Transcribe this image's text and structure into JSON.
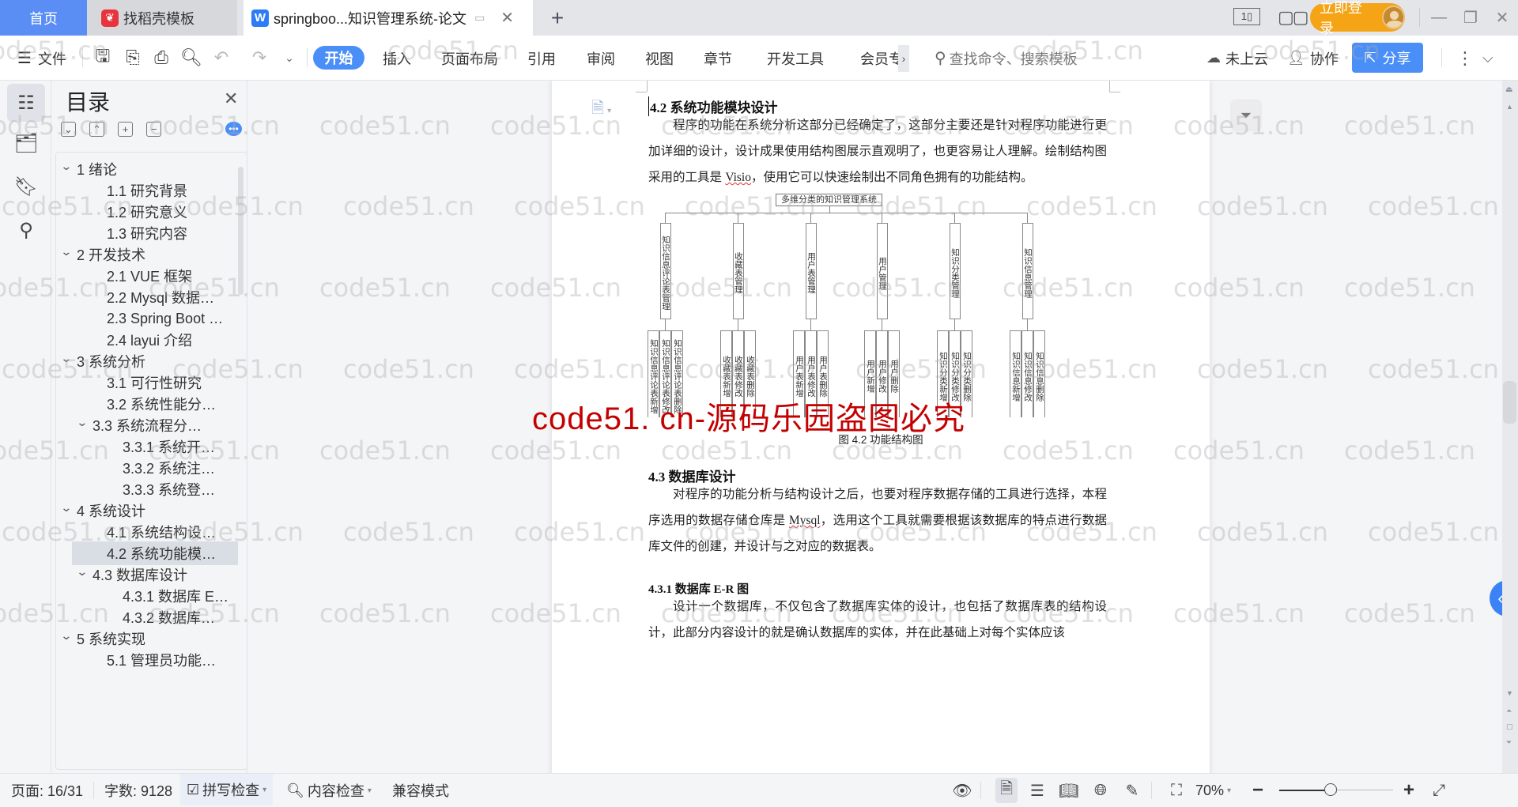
{
  "tabs": {
    "home": "首页",
    "daoke": "找稻壳模板",
    "doc": "springboo...知识管理系统-论文",
    "add": "+"
  },
  "titlebar": {
    "login": "立即登录"
  },
  "toolbar": {
    "file": "文件",
    "menus": [
      "开始",
      "插入",
      "页面布局",
      "引用",
      "审阅",
      "视图",
      "章节",
      "开发工具",
      "会员专"
    ],
    "search_placeholder": "查找命令、搜索模板",
    "cloud": "未上云",
    "collab": "协作",
    "share": "分享"
  },
  "toc": {
    "title": "目录",
    "items": [
      {
        "label": "1  绪论",
        "level": 1,
        "expanded": true
      },
      {
        "label": "1.1  研究背景",
        "level": 2
      },
      {
        "label": "1.2  研究意义",
        "level": 2
      },
      {
        "label": "1.3  研究内容",
        "level": 2
      },
      {
        "label": "2  开发技术",
        "level": 1,
        "expanded": true
      },
      {
        "label": "2.1 VUE 框架",
        "level": 2
      },
      {
        "label": "2.2 Mysql 数据…",
        "level": 2
      },
      {
        "label": "2.3 Spring Boot …",
        "level": 2
      },
      {
        "label": "2.4 layui 介绍",
        "level": 2
      },
      {
        "label": "3  系统分析",
        "level": 1,
        "expanded": true
      },
      {
        "label": "3.1 可行性研究",
        "level": 2
      },
      {
        "label": "3.2 系统性能分…",
        "level": 2
      },
      {
        "label": "3.3  系统流程分…",
        "level": 2,
        "expanded": true
      },
      {
        "label": "3.3.1  系统开…",
        "level": 3
      },
      {
        "label": "3.3.2  系统注…",
        "level": 3
      },
      {
        "label": "3.3.3  系统登…",
        "level": 3
      },
      {
        "label": "4  系统设计",
        "level": 1,
        "expanded": true
      },
      {
        "label": "4.1  系统结构设…",
        "level": 2
      },
      {
        "label": "4.2 系统功能模…",
        "level": 2,
        "selected": true
      },
      {
        "label": "4.3 数据库设计",
        "level": 2,
        "expanded": true
      },
      {
        "label": "4.3.1 数据库 E…",
        "level": 3
      },
      {
        "label": "4.3.2  数据库…",
        "level": 3
      },
      {
        "label": "5  系统实现",
        "level": 1,
        "expanded": true
      },
      {
        "label": "5.1  管理员功能…",
        "level": 2
      }
    ]
  },
  "document": {
    "h_42": "4.2 系统功能模块设计",
    "p1": "程序的功能在系统分析这部分已经确定了，这部分主要还是针对程序功能进行更加详细的设计，设计成果使用结构图展示直观明了，也更容易让人理解。绘制结构图采用的工具是 ",
    "p1_tool": "Visio",
    "p1_end": "，使用它可以快速绘制出不同角色拥有的功能结构。",
    "diagram": {
      "root": "多维分类的知识管理系统",
      "modules": [
        {
          "name": "知识信息评论表管理",
          "children": [
            "知识信息评论表新增",
            "知识信息评论表修改",
            "知识信息评论表删除"
          ]
        },
        {
          "name": "收藏表管理",
          "children": [
            "收藏表新增",
            "收藏表修改",
            "收藏表删除"
          ]
        },
        {
          "name": "用户表管理",
          "children": [
            "用户表新增",
            "用户表修改",
            "用户表删除"
          ]
        },
        {
          "name": "用户管理",
          "children": [
            "用户新增",
            "用户修改",
            "用户删除"
          ]
        },
        {
          "name": "知识分类管理",
          "children": [
            "知识分类新增",
            "知识分类修改",
            "知识分类删除"
          ]
        },
        {
          "name": "知识信息管理",
          "children": [
            "知识信息新增",
            "知识信息修改",
            "知识信息删除"
          ]
        }
      ]
    },
    "caption": "图 4.2  功能结构图",
    "h_43": "4.3 数据库设计",
    "p2": "对程序的功能分析与结构设计之后，也要对程序数据存储的工具进行选择，本程序选用的数据存储仓库是 ",
    "p2_tool": "Mysql",
    "p2_end": "，选用这个工具就需要根据该数据库的特点进行数据库文件的创建，并设计与之对应的数据表。",
    "h_431": "4.3.1 数据库 E-R 图",
    "p3": "设计一个数据库，不仅包含了数据库实体的设计，也包括了数据库表的结构设计，此部分内容设计的就是确认数据库的实体，并在此基础上对每个实体应该"
  },
  "watermark": {
    "text": "code51.cn",
    "banner": "code51. cn-源码乐园盗图必究"
  },
  "status": {
    "page": "页面: 16/31",
    "words": "字数: 9128",
    "spell": "拼写检查",
    "content": "内容检查",
    "compat": "兼容模式",
    "zoom": "70%",
    "zoom_fraction": 0.45
  }
}
